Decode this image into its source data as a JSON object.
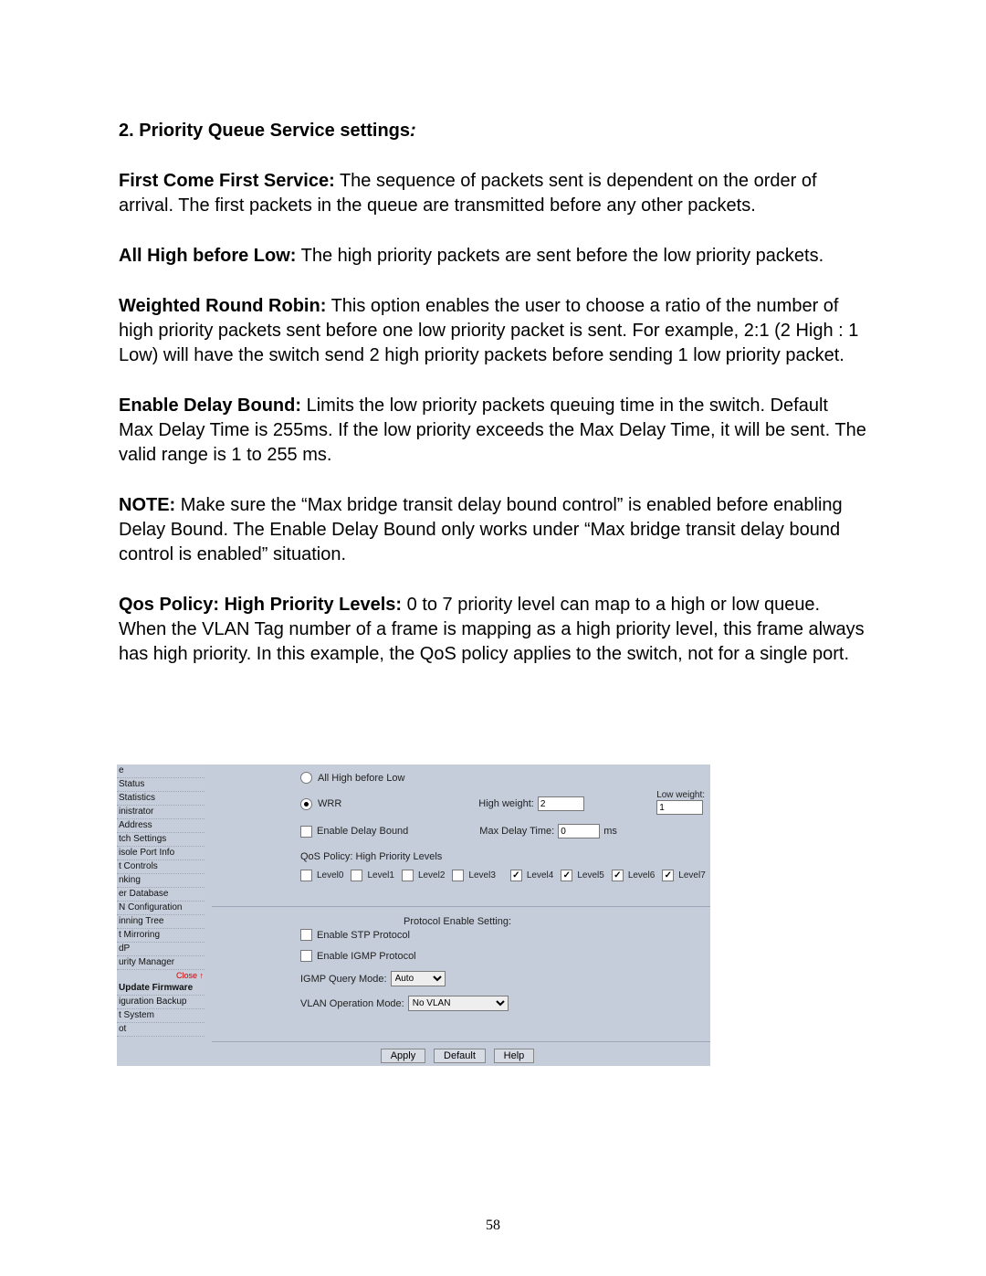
{
  "heading": {
    "prefix": "2. Priority Queue Service settings",
    "suffix": ":"
  },
  "paras": {
    "p1": {
      "label": "First Come First Service:",
      "text": " The sequence of packets sent is dependent on the order of arrival.  The first packets in the queue are transmitted before any other packets."
    },
    "p2": {
      "label": "All High before Low:",
      "text": " The high priority packets are sent before the low priority packets."
    },
    "p3": {
      "label": "Weighted Round Robin:",
      "text": " This option enables the user to choose a ratio of the number of high priority packets sent before one low priority packet is sent. For example, 2:1 (2 High : 1 Low) will have the switch send 2 high priority packets before sending 1 low priority packet."
    },
    "p4": {
      "label": "Enable Delay Bound:",
      "text": " Limits the low priority packets queuing time in the switch. Default Max Delay Time is 255ms. If the low priority exceeds the Max Delay Time, it will be sent. The valid range is 1 to 255 ms."
    },
    "p5": {
      "label": "NOTE:",
      "text": " Make sure the “Max bridge transit delay bound control” is enabled before enabling Delay Bound. The Enable Delay Bound only works under “Max bridge transit delay bound control is enabled” situation."
    },
    "p6": {
      "label": "Qos Policy: High Priority Levels:",
      "text": " 0 to 7 priority level can map to a high or low queue. When the VLAN Tag number of a frame is mapping as a high priority level, this frame always has high priority. In this example, the QoS policy applies to the switch, not for a single port."
    }
  },
  "sidebar": [
    "e",
    "Status",
    "Statistics",
    "inistrator",
    "Address",
    "tch Settings",
    "isole Port Info",
    "t Controls",
    "nking",
    "er Database",
    "N Configuration",
    "inning Tree",
    "t Mirroring",
    "dP",
    "urity Manager"
  ],
  "sidebar_red": "Close",
  "sidebar_red_arrow": "↑",
  "sidebar2": [
    "Update Firmware",
    "iguration Backup",
    "t System",
    "ot"
  ],
  "form": {
    "opt_allhigh": "All High before Low",
    "opt_wrr": "WRR",
    "high_weight_lbl": "High weight:",
    "high_weight_val": "2",
    "low_weight_lbl": "Low weight:",
    "low_weight_val": "1",
    "enable_delay": "Enable Delay Bound",
    "max_delay_lbl": "Max Delay Time:",
    "max_delay_val": "0",
    "ms": "ms",
    "qos_lbl": "QoS Policy: High Priority Levels",
    "levels": {
      "l0": "Level0",
      "l1": "Level1",
      "l2": "Level2",
      "l3": "Level3",
      "l4": "Level4",
      "l5": "Level5",
      "l6": "Level6",
      "l7": "Level7"
    },
    "prot_hdr": "Protocol Enable Setting:",
    "stp": "Enable STP Protocol",
    "igmp": "Enable IGMP Protocol",
    "igmp_query_lbl": "IGMP Query Mode:",
    "igmp_query_val": "Auto",
    "vlan_lbl": "VLAN Operation Mode:",
    "vlan_val": "No VLAN",
    "btn_apply": "Apply",
    "btn_default": "Default",
    "btn_help": "Help"
  },
  "page_number": "58"
}
